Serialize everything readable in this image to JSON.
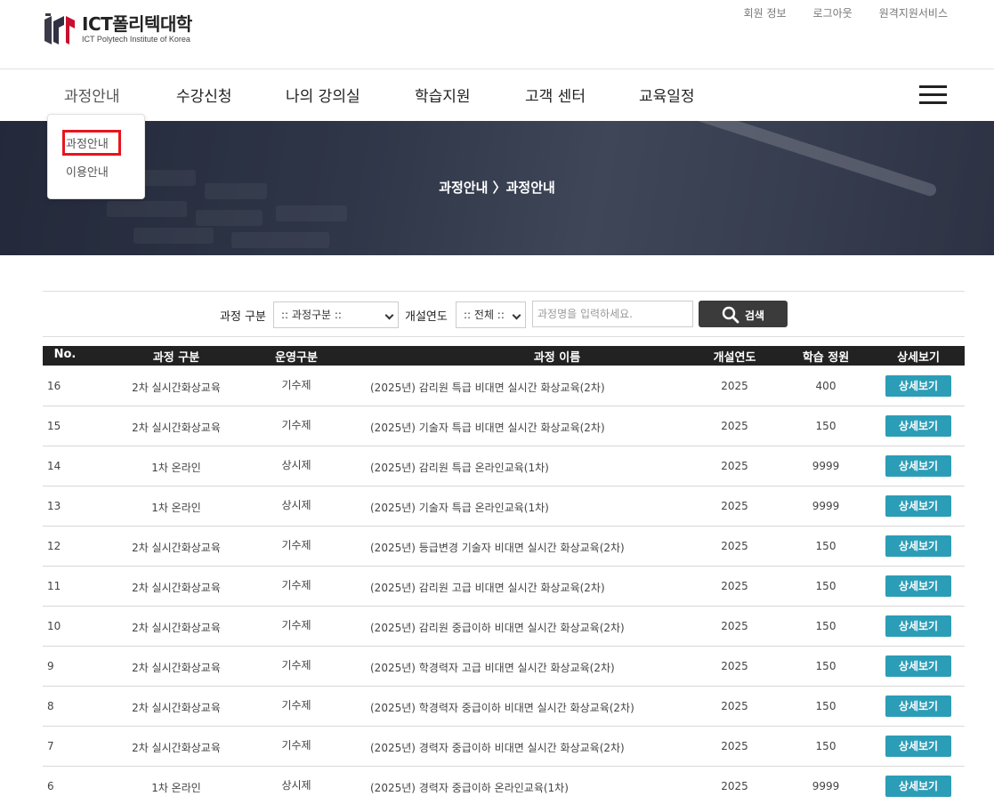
{
  "header": {
    "logo_title": "ICT폴리텍대학",
    "logo_sub": "ICT Polytech Institute of Korea",
    "util_links": [
      "회원 정보",
      "로그아웃",
      "원격지원서비스"
    ]
  },
  "gnb": {
    "items": [
      "과정안내",
      "수강신청",
      "나의 강의실",
      "학습지원",
      "고객 센터",
      "교육일정"
    ]
  },
  "dropdown": {
    "items": [
      "과정안내",
      "이용안내"
    ]
  },
  "banner": {
    "title": "과정안내 〉과정안내"
  },
  "search": {
    "category_label": "과정 구분",
    "category_value": ":: 과정구분 ::",
    "year_label": "개설연도",
    "year_value": ":: 전체 ::",
    "keyword_placeholder": "과정명을 입력하세요.",
    "button_label": "검색"
  },
  "table": {
    "headers": [
      "No.",
      "과정 구분",
      "운영구분",
      "과정 이름",
      "개설연도",
      "학습 정원",
      "상세보기"
    ],
    "detail_label": "상세보기",
    "rows": [
      {
        "no": "16",
        "cat": "2차 실시간화상교육",
        "op": "기수제",
        "name": "(2025년) 감리원 특급 비대면 실시간 화상교육(2차)",
        "year": "2025",
        "cap": "400"
      },
      {
        "no": "15",
        "cat": "2차 실시간화상교육",
        "op": "기수제",
        "name": "(2025년) 기술자 특급 비대면 실시간 화상교육(2차)",
        "year": "2025",
        "cap": "150"
      },
      {
        "no": "14",
        "cat": "1차 온라인",
        "op": "상시제",
        "name": "(2025년) 감리원 특급 온라인교육(1차)",
        "year": "2025",
        "cap": "9999"
      },
      {
        "no": "13",
        "cat": "1차 온라인",
        "op": "상시제",
        "name": "(2025년) 기술자 특급 온라인교육(1차)",
        "year": "2025",
        "cap": "9999"
      },
      {
        "no": "12",
        "cat": "2차 실시간화상교육",
        "op": "기수제",
        "name": "(2025년) 등급변경 기술자 비대면 실시간 화상교육(2차)",
        "year": "2025",
        "cap": "150"
      },
      {
        "no": "11",
        "cat": "2차 실시간화상교육",
        "op": "기수제",
        "name": "(2025년) 감리원 고급 비대면 실시간 화상교육(2차)",
        "year": "2025",
        "cap": "150"
      },
      {
        "no": "10",
        "cat": "2차 실시간화상교육",
        "op": "기수제",
        "name": "(2025년) 감리원 중급이하 비대면 실시간 화상교육(2차)",
        "year": "2025",
        "cap": "150"
      },
      {
        "no": "9",
        "cat": "2차 실시간화상교육",
        "op": "기수제",
        "name": "(2025년) 학경력자 고급 비대면 실시간 화상교육(2차)",
        "year": "2025",
        "cap": "150"
      },
      {
        "no": "8",
        "cat": "2차 실시간화상교육",
        "op": "기수제",
        "name": "(2025년) 학경력자 중급이하 비대면 실시간 화상교육(2차)",
        "year": "2025",
        "cap": "150"
      },
      {
        "no": "7",
        "cat": "2차 실시간화상교육",
        "op": "기수제",
        "name": "(2025년) 경력자 중급이하 비대면 실시간 화상교육(2차)",
        "year": "2025",
        "cap": "150"
      },
      {
        "no": "6",
        "cat": "1차 온라인",
        "op": "상시제",
        "name": "(2025년) 경력자 중급이하 온라인교육(1차)",
        "year": "2025",
        "cap": "9999"
      }
    ]
  },
  "colors": {
    "detail_button": "#2c9db6",
    "search_button": "#3b3b3b",
    "table_header": "#222222",
    "highlight_box": "#e8141e"
  }
}
